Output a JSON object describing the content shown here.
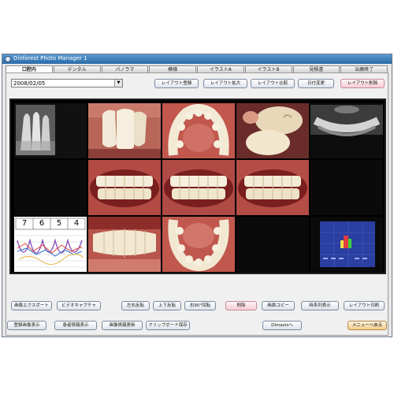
{
  "window": {
    "title": "Dinforest Photo Manager 1",
    "accent_color": "#2a6aa8"
  },
  "tabs": [
    "口腔内",
    "デンタル",
    "パノラマ",
    "模様",
    "イラストA",
    "イラストB",
    "見積書",
    "治療終了"
  ],
  "active_tab_index": 0,
  "date_select": {
    "value": "2008/02/05"
  },
  "layout_buttons": [
    "レイアウト登録",
    "レイアウト拡大",
    "レイアウト比較",
    "日付変更",
    "レイアウト削除"
  ],
  "panels": [
    {
      "icon": "dental-xray-photo"
    },
    {
      "icon": "front-teeth-closeup-photo"
    },
    {
      "icon": "upper-arch-occlusal-photo"
    },
    {
      "icon": "molar-closeup-photo"
    },
    {
      "icon": "panoramic-xray-photo"
    },
    {
      "icon": "empty-slot"
    },
    {
      "icon": "right-bite-photo"
    },
    {
      "icon": "frontal-bite-photo"
    },
    {
      "icon": "left-bite-photo"
    },
    {
      "icon": "empty-slot"
    },
    {
      "icon": "periodontal-chart"
    },
    {
      "icon": "lower-teeth-photo"
    },
    {
      "icon": "lower-arch-occlusal-photo"
    },
    {
      "icon": "empty-slot"
    },
    {
      "icon": "blue-diagnostic-chart"
    }
  ],
  "perio_chart": {
    "tooth_numbers": [
      "7",
      "6",
      "5",
      "4"
    ]
  },
  "action_buttons": [
    "画像エクスポート",
    "ビデオキャプチャ",
    "左右反転",
    "上下反転",
    "右90°回転",
    "削除",
    "画面コピー",
    "時系列表示",
    "レイアウト印刷"
  ],
  "bottom_buttons": [
    "登録画像表示",
    "患者情報表示",
    "画像情報更新",
    "クリップボード保存",
    "Dimaxisへ",
    "メニューへ戻る"
  ]
}
